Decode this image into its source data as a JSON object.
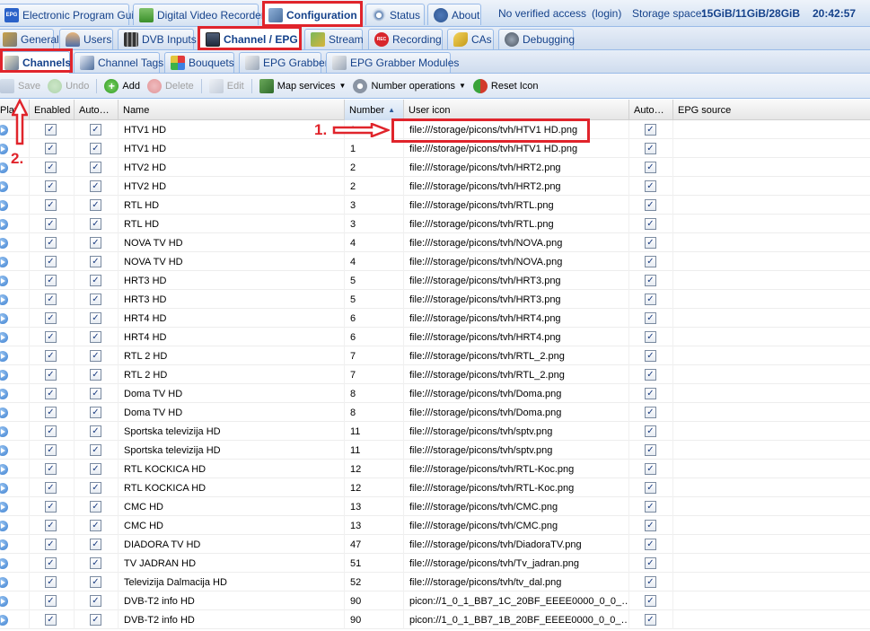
{
  "top_tabs": [
    {
      "label": "Electronic Program Guide",
      "icon": "epg-icon"
    },
    {
      "label": "Digital Video Recorder",
      "icon": "download-icon"
    },
    {
      "label": "Configuration",
      "icon": "wrench-icon"
    },
    {
      "label": "Status",
      "icon": "eye-icon"
    },
    {
      "label": "About",
      "icon": "info-icon"
    }
  ],
  "epg_icon_text": "EPG",
  "status_bar": {
    "access": "No verified access",
    "login": "(login)",
    "storage_label": "Storage space:",
    "storage_value": "15GiB/11GiB/28GiB",
    "time": "20:42:57"
  },
  "config_tabs": [
    {
      "label": "General",
      "icon": "tools-icon"
    },
    {
      "label": "Users",
      "icon": "users-icon"
    },
    {
      "label": "DVB Inputs",
      "icon": "film-icon"
    },
    {
      "label": "Channel / EPG",
      "icon": "tv-icon"
    },
    {
      "label": "Stream",
      "icon": "stream-icon"
    },
    {
      "label": "Recording",
      "icon": "rec-icon"
    },
    {
      "label": "CAs",
      "icon": "key-icon"
    },
    {
      "label": "Debugging",
      "icon": "bug-icon"
    }
  ],
  "rec_icon_text": "REC",
  "sub_tabs": [
    {
      "label": "Channels",
      "icon": "pencil-icon"
    },
    {
      "label": "Channel Tags",
      "icon": "tag-icon"
    },
    {
      "label": "Bouquets",
      "icon": "grid-icon"
    },
    {
      "label": "EPG Grabber",
      "icon": "grabber-icon"
    },
    {
      "label": "EPG Grabber Modules",
      "icon": "grabber-modules-icon"
    }
  ],
  "toolbar": {
    "save": "Save",
    "undo": "Undo",
    "add": "Add",
    "delete": "Delete",
    "edit": "Edit",
    "map_services": "Map services",
    "number_operations": "Number operations",
    "reset_icon": "Reset Icon"
  },
  "columns": [
    "Play",
    "Enabled",
    "Auto…",
    "Name",
    "Number",
    "User icon",
    "Auto…",
    "EPG source"
  ],
  "rows": [
    {
      "name": "HTV1 HD",
      "number": "1",
      "icon": "file:///storage/picons/tvh/HTV1 HD.png"
    },
    {
      "name": "HTV1 HD",
      "number": "1",
      "icon": "file:///storage/picons/tvh/HTV1 HD.png"
    },
    {
      "name": "HTV2 HD",
      "number": "2",
      "icon": "file:///storage/picons/tvh/HRT2.png"
    },
    {
      "name": "HTV2 HD",
      "number": "2",
      "icon": "file:///storage/picons/tvh/HRT2.png"
    },
    {
      "name": "RTL HD",
      "number": "3",
      "icon": "file:///storage/picons/tvh/RTL.png"
    },
    {
      "name": "RTL HD",
      "number": "3",
      "icon": "file:///storage/picons/tvh/RTL.png"
    },
    {
      "name": "NOVA TV HD",
      "number": "4",
      "icon": "file:///storage/picons/tvh/NOVA.png"
    },
    {
      "name": "NOVA TV HD",
      "number": "4",
      "icon": "file:///storage/picons/tvh/NOVA.png"
    },
    {
      "name": "HRT3 HD",
      "number": "5",
      "icon": "file:///storage/picons/tvh/HRT3.png"
    },
    {
      "name": "HRT3 HD",
      "number": "5",
      "icon": "file:///storage/picons/tvh/HRT3.png"
    },
    {
      "name": "HRT4 HD",
      "number": "6",
      "icon": "file:///storage/picons/tvh/HRT4.png"
    },
    {
      "name": "HRT4 HD",
      "number": "6",
      "icon": "file:///storage/picons/tvh/HRT4.png"
    },
    {
      "name": "RTL 2 HD",
      "number": "7",
      "icon": "file:///storage/picons/tvh/RTL_2.png"
    },
    {
      "name": "RTL 2 HD",
      "number": "7",
      "icon": "file:///storage/picons/tvh/RTL_2.png"
    },
    {
      "name": "Doma TV HD",
      "number": "8",
      "icon": "file:///storage/picons/tvh/Doma.png"
    },
    {
      "name": "Doma TV HD",
      "number": "8",
      "icon": "file:///storage/picons/tvh/Doma.png"
    },
    {
      "name": "Sportska televizija HD",
      "number": "11",
      "icon": "file:///storage/picons/tvh/sptv.png"
    },
    {
      "name": "Sportska televizija HD",
      "number": "11",
      "icon": "file:///storage/picons/tvh/sptv.png"
    },
    {
      "name": "RTL KOCKICA HD",
      "number": "12",
      "icon": "file:///storage/picons/tvh/RTL-Koc.png"
    },
    {
      "name": "RTL KOCKICA HD",
      "number": "12",
      "icon": "file:///storage/picons/tvh/RTL-Koc.png"
    },
    {
      "name": "CMC HD",
      "number": "13",
      "icon": "file:///storage/picons/tvh/CMC.png"
    },
    {
      "name": "CMC HD",
      "number": "13",
      "icon": "file:///storage/picons/tvh/CMC.png"
    },
    {
      "name": "DIADORA TV HD",
      "number": "47",
      "icon": "file:///storage/picons/tvh/DiadoraTV.png"
    },
    {
      "name": "TV JADRAN HD",
      "number": "51",
      "icon": "file:///storage/picons/tvh/Tv_jadran.png"
    },
    {
      "name": "Televizija Dalmacija HD",
      "number": "52",
      "icon": "file:///storage/picons/tvh/tv_dal.png"
    },
    {
      "name": "DVB-T2 info HD",
      "number": "90",
      "icon": "picon://1_0_1_BB7_1C_20BF_EEEE0000_0_0_…"
    },
    {
      "name": "DVB-T2 info HD",
      "number": "90",
      "icon": "picon://1_0_1_BB7_1B_20BF_EEEE0000_0_0_…"
    }
  ],
  "annotations": {
    "step1": "1.",
    "step2": "2."
  },
  "colors": {
    "accent_red": "#e0242b",
    "tab_text": "#15428b"
  }
}
